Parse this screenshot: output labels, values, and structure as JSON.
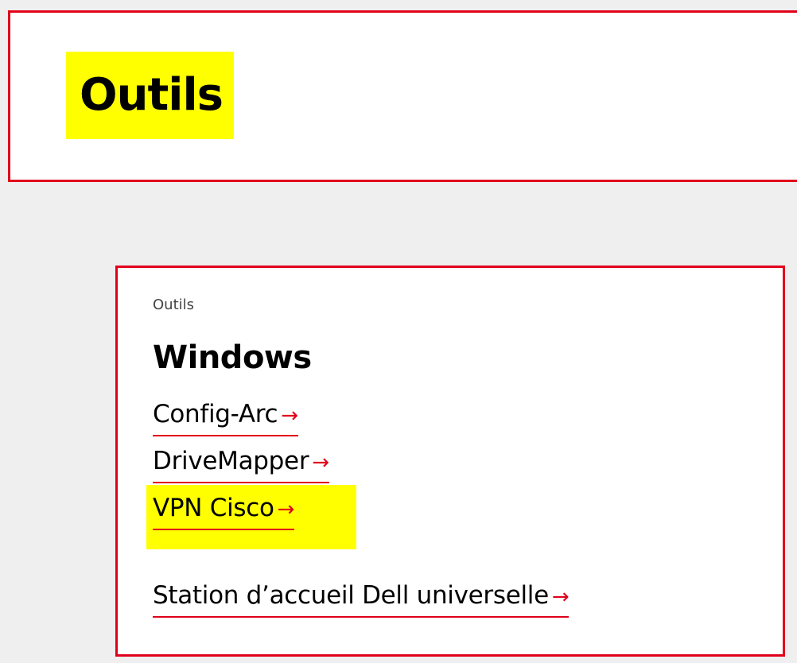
{
  "header": {
    "title": "Outils"
  },
  "card": {
    "eyebrow": "Outils",
    "title": "Windows",
    "links": [
      {
        "label": "Config-Arc",
        "arrow": "→"
      },
      {
        "label": "DriveMapper",
        "arrow": "→"
      },
      {
        "label": "VPN Cisco",
        "arrow": "→",
        "highlighted": true
      },
      {
        "label": "Station d’accueil Dell universelle",
        "arrow": "→"
      }
    ]
  },
  "colors": {
    "accent": "#e1001a",
    "highlight": "#ffff00",
    "background": "#efefef"
  }
}
